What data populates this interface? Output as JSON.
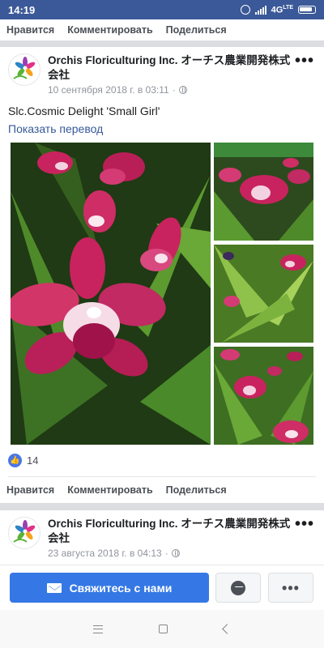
{
  "status_bar": {
    "time": "14:19",
    "network": "4G",
    "network_sub": "LTE"
  },
  "top_actions": {
    "like": "Нравится",
    "comment": "Комментировать",
    "share": "Поделиться"
  },
  "post1": {
    "page_name": "Orchis Floriculturing Inc. オーチス農業開発株式会社",
    "timestamp": "10 сентября 2018 г. в 03:11",
    "more": "•••",
    "text": "Slc.Cosmic Delight 'Small Girl'",
    "translate": "Показать перевод",
    "likes": "14",
    "actions": {
      "like": "Нравится",
      "comment": "Комментировать",
      "share": "Поделиться"
    }
  },
  "post2": {
    "page_name": "Orchis Floriculturing Inc. オーチス農業開発株式会社",
    "timestamp": "23 августа 2018 г. в 04:13",
    "more": "•••"
  },
  "bottom_bar": {
    "contact_label": "Свяжитесь с нами",
    "more": "•••"
  },
  "colors": {
    "brand": "#3b5998",
    "button": "#3578e5",
    "link": "#365899",
    "flower": "#c8235e"
  }
}
